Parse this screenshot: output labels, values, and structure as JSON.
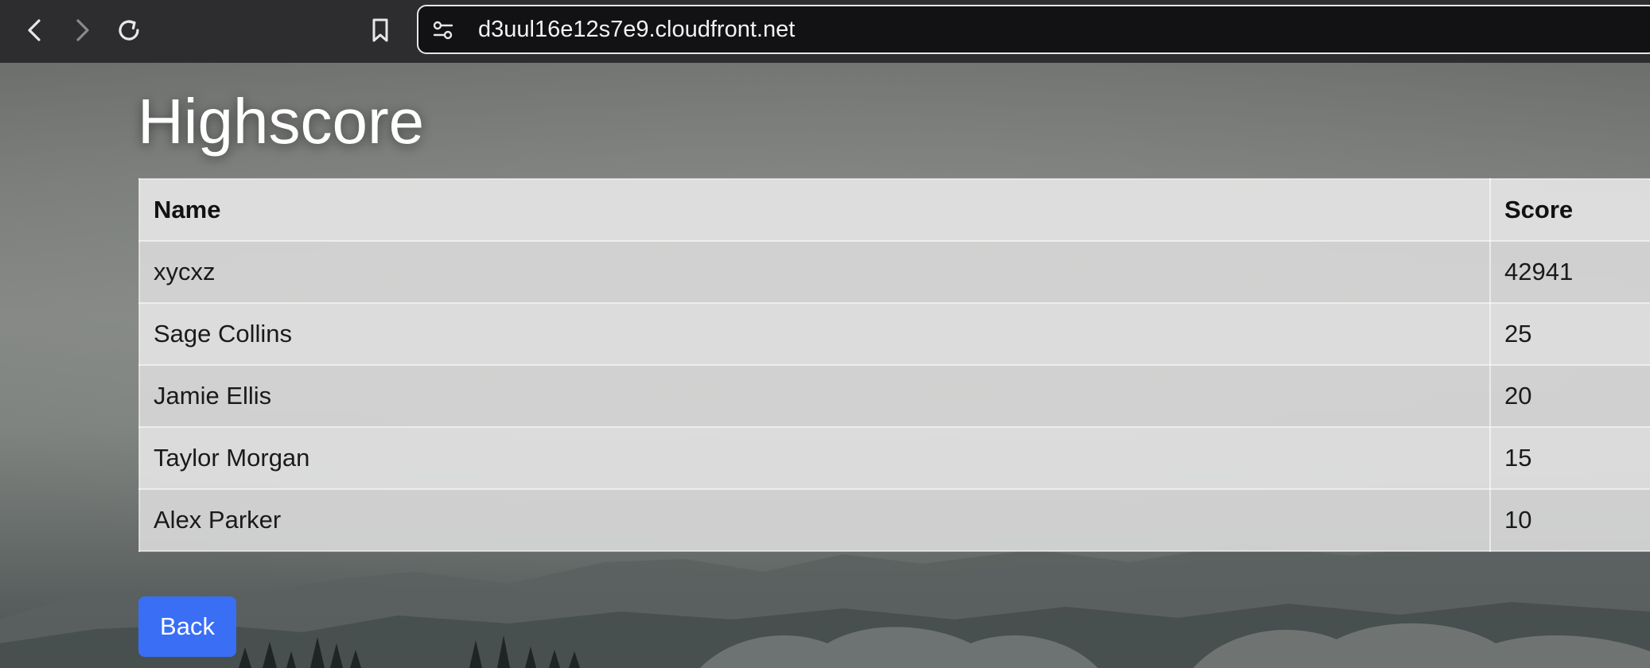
{
  "browser": {
    "url": "d3uul16e12s7e9.cloudfront.net",
    "icons": [
      "back-arrow-icon",
      "forward-arrow-icon",
      "reload-icon",
      "bookmark-icon",
      "site-settings-icon"
    ]
  },
  "page": {
    "title": "Highscore",
    "table": {
      "headers": {
        "name": "Name",
        "score": "Score"
      },
      "rows": [
        {
          "name": "xycxz",
          "score": "42941"
        },
        {
          "name": "Sage Collins",
          "score": "25"
        },
        {
          "name": "Jamie Ellis",
          "score": "20"
        },
        {
          "name": "Taylor Morgan",
          "score": "15"
        },
        {
          "name": "Alex Parker",
          "score": "10"
        }
      ]
    },
    "back_label": "Back"
  },
  "colors": {
    "toolbar": "#2d2d30",
    "address_bar": "#121214",
    "button": "#3a6ff5"
  }
}
